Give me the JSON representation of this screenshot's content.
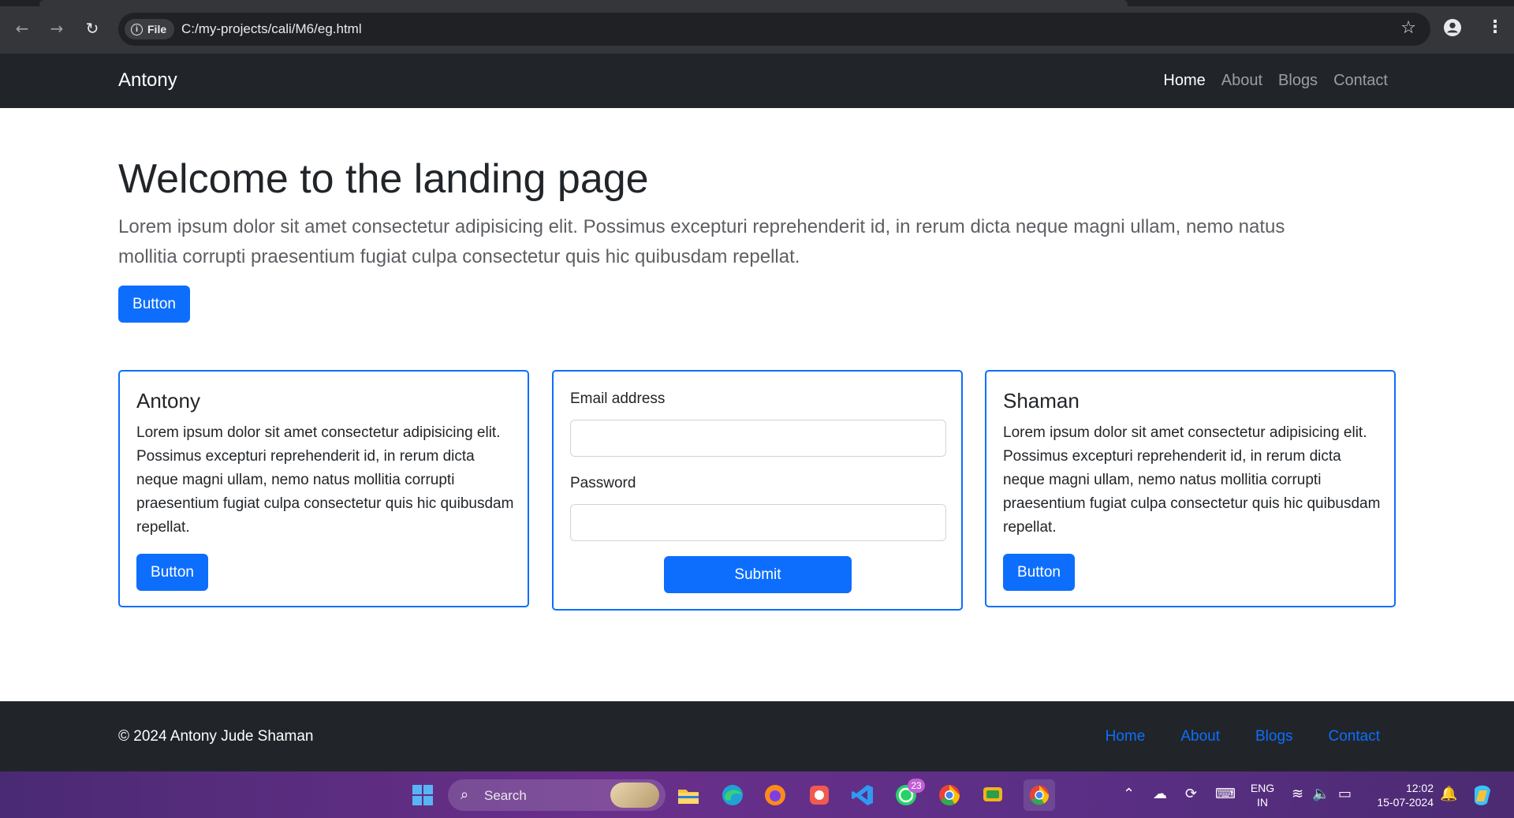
{
  "browser": {
    "chip_label": "File",
    "url": "C:/my-projects/cali/M6/eg.html",
    "back_icon": "←",
    "forward_icon": "→",
    "reload_icon": "↻",
    "star_icon": "☆",
    "menu_icon": "⋮"
  },
  "navbar": {
    "brand": "Antony",
    "links": [
      "Home",
      "About",
      "Blogs",
      "Contact"
    ],
    "active_link": "Home"
  },
  "hero": {
    "title": "Welcome to the landing page",
    "lead": "Lorem ipsum dolor sit amet consectetur adipisicing elit. Possimus excepturi reprehenderit id, in rerum dicta neque magni ullam, nemo natus mollitia corrupti praesentium fugiat culpa consectetur quis hic quibusdam repellat.",
    "button": "Button"
  },
  "cards": {
    "left": {
      "title": "Antony",
      "text": "Lorem ipsum dolor sit amet consectetur adipisicing elit. Possimus excepturi reprehenderit id, in rerum dicta neque magni ullam, nemo natus mollitia corrupti praesentium fugiat culpa consectetur quis hic quibusdam repellat.",
      "button": "Button"
    },
    "form": {
      "email_label": "Email address",
      "email_value": "",
      "password_label": "Password",
      "password_value": "",
      "submit": "Submit"
    },
    "right": {
      "title": "Shaman",
      "text": "Lorem ipsum dolor sit amet consectetur adipisicing elit. Possimus excepturi reprehenderit id, in rerum dicta neque magni ullam, nemo natus mollitia corrupti praesentium fugiat culpa consectetur quis hic quibusdam repellat.",
      "button": "Button"
    }
  },
  "footer": {
    "copyright": "© 2024 Antony Jude Shaman",
    "links": [
      "Home",
      "About",
      "Blogs",
      "Contact"
    ]
  },
  "taskbar": {
    "search_label": "Search",
    "whatsapp_badge": "23",
    "language_line1": "ENG",
    "language_line2": "IN",
    "time": "12:02",
    "date": "15-07-2024"
  },
  "colors": {
    "primary": "#0d6efd",
    "navbar_bg": "#212529",
    "chrome_bg": "#35363a"
  }
}
